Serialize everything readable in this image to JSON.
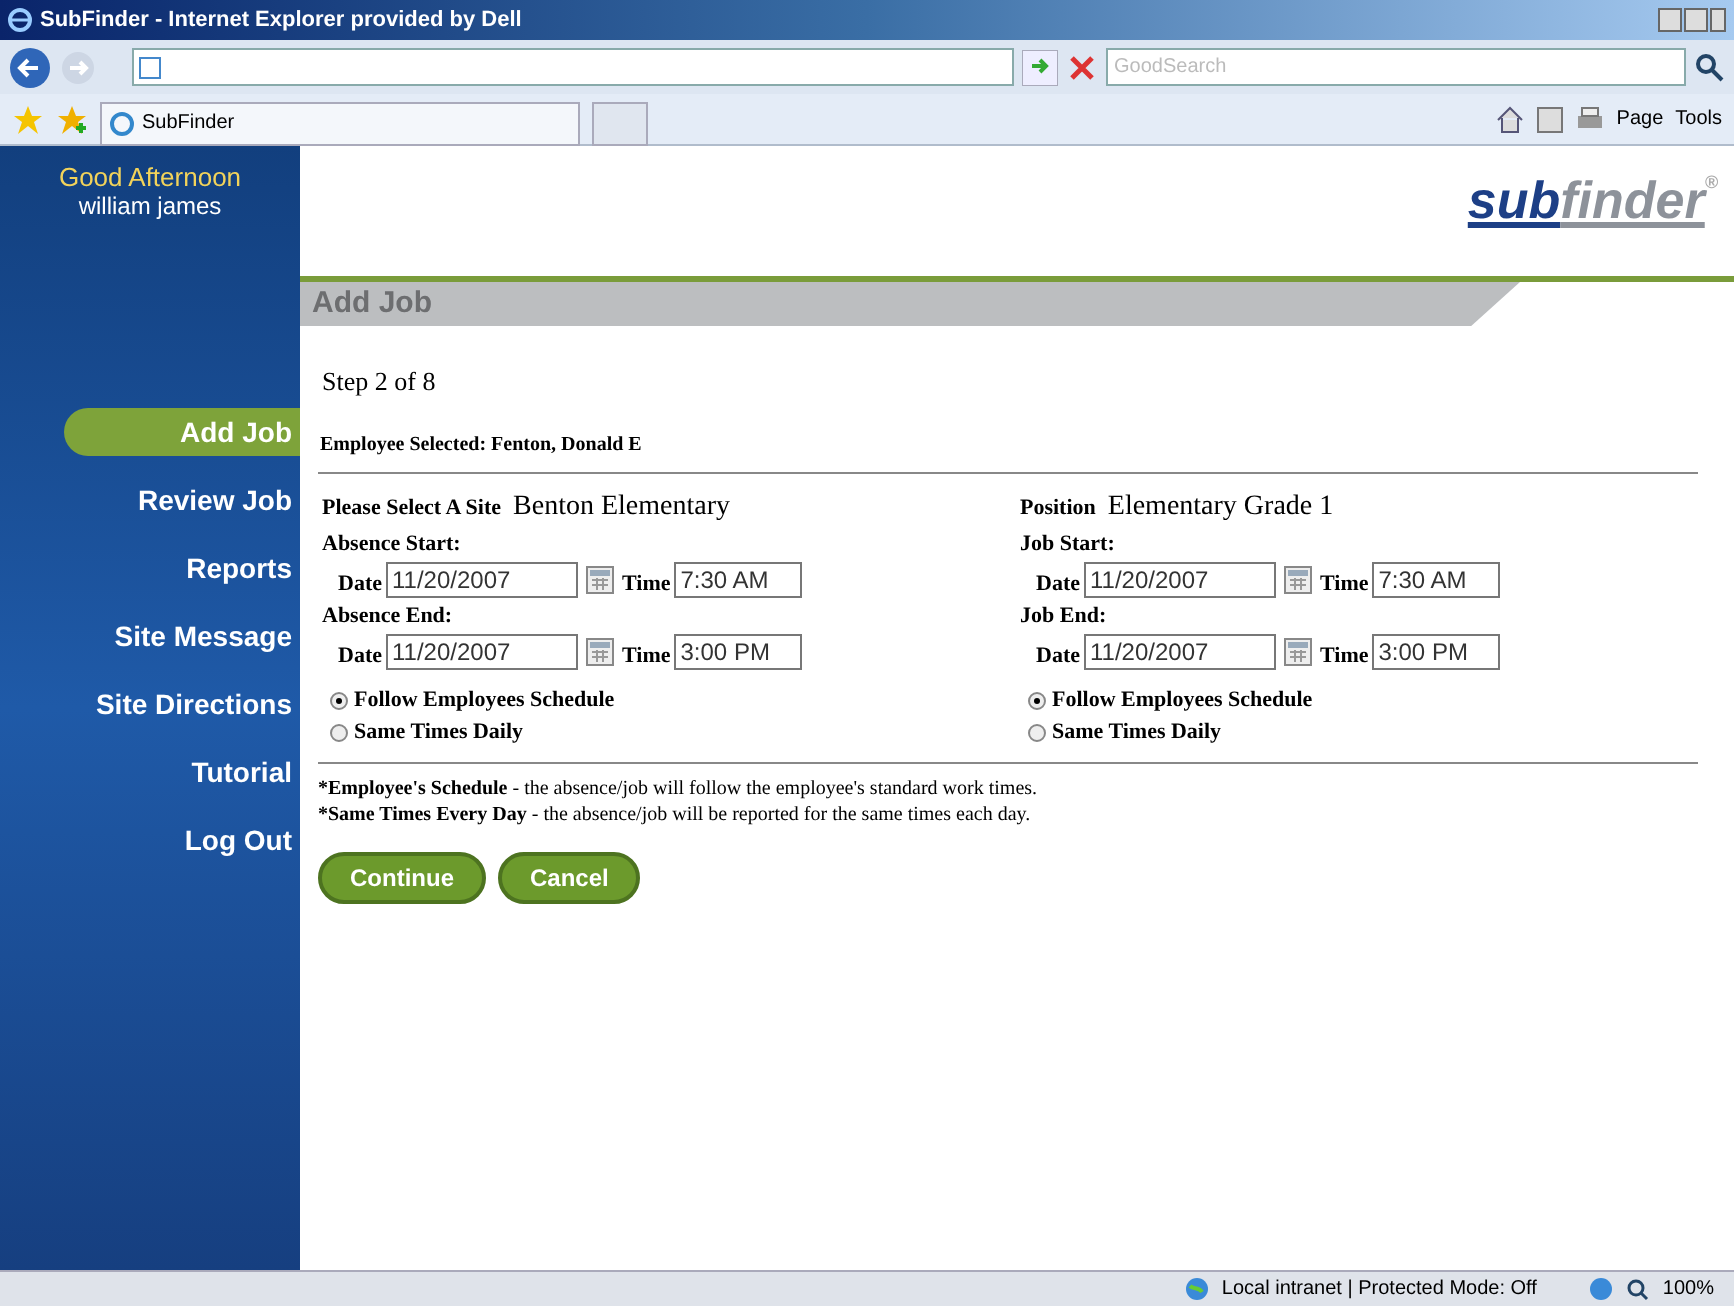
{
  "window": {
    "title": "SubFinder - Internet Explorer provided by Dell"
  },
  "browser": {
    "search_placeholder": "GoodSearch",
    "tab": "SubFinder",
    "toolbar": [
      "Page",
      "Tools"
    ],
    "status": "Local intranet | Protected Mode: Off",
    "zoom": "100%"
  },
  "sidebar": {
    "greeting": "Good Afternoon",
    "user": "william james",
    "items": [
      {
        "label": "Add Job",
        "selected": true
      },
      {
        "label": "Review Job",
        "selected": false
      },
      {
        "label": "Reports",
        "selected": false
      },
      {
        "label": "Site Message",
        "selected": false
      },
      {
        "label": "Site Directions",
        "selected": false
      },
      {
        "label": "Tutorial",
        "selected": false
      },
      {
        "label": "Log Out",
        "selected": false
      }
    ]
  },
  "logo": {
    "part_1": "sub",
    "part_2": "finder",
    "mark": "®"
  },
  "page_title": "Add Job",
  "step": "Step 2 of 8",
  "employee": "Employee Selected: Fenton, Donald E",
  "columns": [
    {
      "label": "Please Select A Site",
      "value": "Benton Elementary",
      "blocks": [
        {
          "heading": "Absence Start:",
          "date_label": "Date",
          "date": "11/20/2007",
          "time_label": "Time",
          "time": "7:30 AM"
        },
        {
          "heading": "Absence End:",
          "date_label": "Date",
          "date": "11/20/2007",
          "time_label": "Time",
          "time": "3:00 PM"
        }
      ],
      "options": [
        {
          "label": "Follow Employees Schedule",
          "selected": true
        },
        {
          "label": "Same Times Daily",
          "selected": false
        }
      ]
    },
    {
      "label": "Position",
      "value": "Elementary Grade 1",
      "blocks": [
        {
          "heading": "Job Start:",
          "date_label": "Date",
          "date": "11/20/2007",
          "time_label": "Time",
          "time": "7:30 AM"
        },
        {
          "heading": "Job End:",
          "date_label": "Date",
          "date": "11/20/2007",
          "time_label": "Time",
          "time": "3:00 PM"
        }
      ],
      "options": [
        {
          "label": "Follow Employees Schedule",
          "selected": true
        },
        {
          "label": "Same Times Daily",
          "selected": false
        }
      ]
    }
  ],
  "notes": [
    {
      "term": "*Employee's Schedule",
      "text": " - the absence/job will follow the employee's standard work times."
    },
    {
      "term": "*Same Times Every Day",
      "text": " - the absence/job will be reported for the same times each day."
    }
  ],
  "buttons": [
    "Continue",
    "Cancel"
  ]
}
